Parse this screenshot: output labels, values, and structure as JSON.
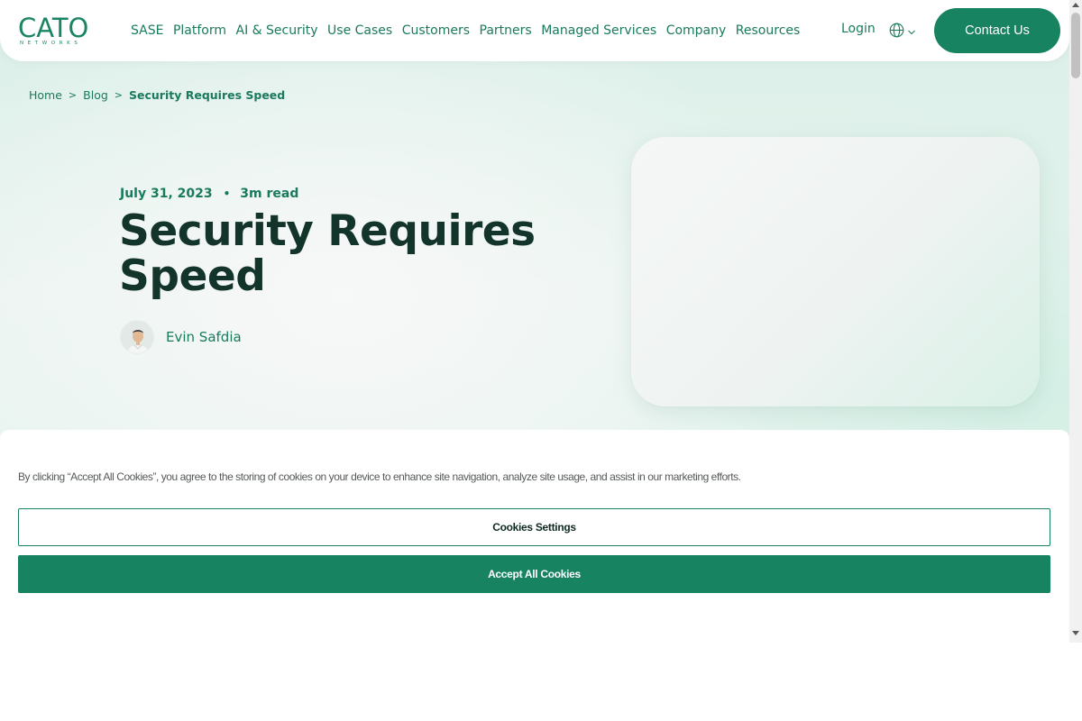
{
  "header": {
    "logo": {
      "text": "CATO",
      "subtext": "NETWORKS"
    },
    "nav": [
      {
        "label": "SASE",
        "name": "nav-sase"
      },
      {
        "label": "Platform",
        "name": "nav-platform"
      },
      {
        "label": "AI & Security",
        "name": "nav-ai-security"
      },
      {
        "label": "Use Cases",
        "name": "nav-use-cases"
      },
      {
        "label": "Customers",
        "name": "nav-customers"
      },
      {
        "label": "Partners",
        "name": "nav-partners"
      },
      {
        "label": "Managed Services",
        "name": "nav-managed-services"
      },
      {
        "label": "Company",
        "name": "nav-company"
      },
      {
        "label": "Resources",
        "name": "nav-resources"
      }
    ],
    "login_label": "Login",
    "language_icon": "globe-icon",
    "contact_label": "Contact Us"
  },
  "breadcrumb": {
    "home": "Home",
    "blog": "Blog",
    "current": "Security Requires Speed",
    "separator": ">"
  },
  "article": {
    "date": "July 31, 2023",
    "separator": "•",
    "read_time": "3m read",
    "title": "Security Requires Speed",
    "author": "Evin Safdia"
  },
  "cookie_banner": {
    "text": "By clicking “Accept All Cookies”, you agree to the storing of cookies on your device to enhance site navigation, analyze site usage, and assist in our marketing efforts.",
    "settings_label": "Cookies Settings",
    "accept_label": "Accept All Cookies"
  },
  "colors": {
    "brand_green": "#178361",
    "link_green": "#1a7a5d",
    "title_dark": "#12342a"
  }
}
